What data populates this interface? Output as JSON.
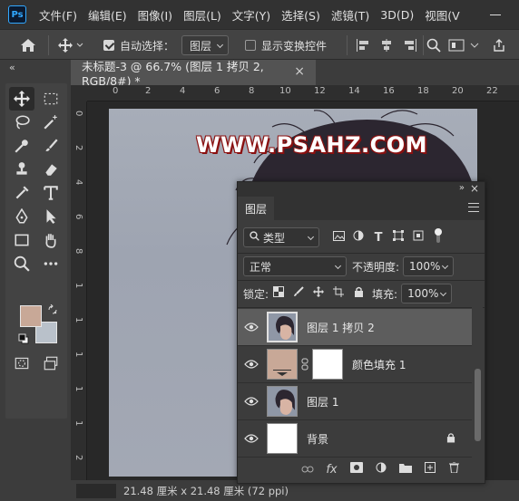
{
  "app": {
    "logo": "Ps"
  },
  "menu": [
    "文件(F)",
    "编辑(E)",
    "图像(I)",
    "图层(L)",
    "文字(Y)",
    "选择(S)",
    "滤镜(T)",
    "3D(D)",
    "视图(V"
  ],
  "options_bar": {
    "auto_select_label": "自动选择：",
    "auto_select_checked": true,
    "target_value": "图层",
    "show_transform_label": "显示变换控件",
    "show_transform_checked": false
  },
  "document": {
    "tab_title": "未标题-3 @ 66.7% (图层 1 拷贝 2, RGB/8#) *",
    "zoom": "66.7%",
    "watermark": "WWW.PSAHZ.COM",
    "status": "21.48 厘米 x 21.48 厘米 (72 ppi)"
  },
  "ruler": {
    "top": [
      "0",
      "2",
      "4",
      "6",
      "8",
      "10",
      "12",
      "14",
      "16",
      "18",
      "20",
      "22"
    ],
    "left": [
      "0",
      "2",
      "4",
      "6",
      "8",
      "1",
      "1",
      "1",
      "1",
      "1",
      "2"
    ]
  },
  "colors": {
    "foreground": "#c8a897",
    "background": "#b9c1ca",
    "fill_layer": "#c8a897"
  },
  "tools": [
    "move-icon",
    "marquee-icon",
    "lasso-icon",
    "magic-wand-icon",
    "eyedropper-icon",
    "brush-icon",
    "stamp-icon",
    "eraser-icon",
    "history-brush-icon",
    "type-icon",
    "pen-icon",
    "path-select-icon",
    "rectangle-icon",
    "hand-icon",
    "zoom-icon",
    "more-icon"
  ],
  "layers_panel": {
    "tab": "图层",
    "filter_kind": "类型",
    "blend_mode": "正常",
    "opacity_label": "不透明度:",
    "opacity": "100%",
    "lock_label": "锁定:",
    "fill_label": "填充:",
    "fill": "100%",
    "layers": [
      {
        "name": "图层 1 拷贝 2",
        "selected": true
      },
      {
        "name": "颜色填充 1",
        "selected": false
      },
      {
        "name": "图层 1",
        "selected": false
      },
      {
        "name": "背景",
        "selected": false,
        "locked": true
      }
    ]
  }
}
